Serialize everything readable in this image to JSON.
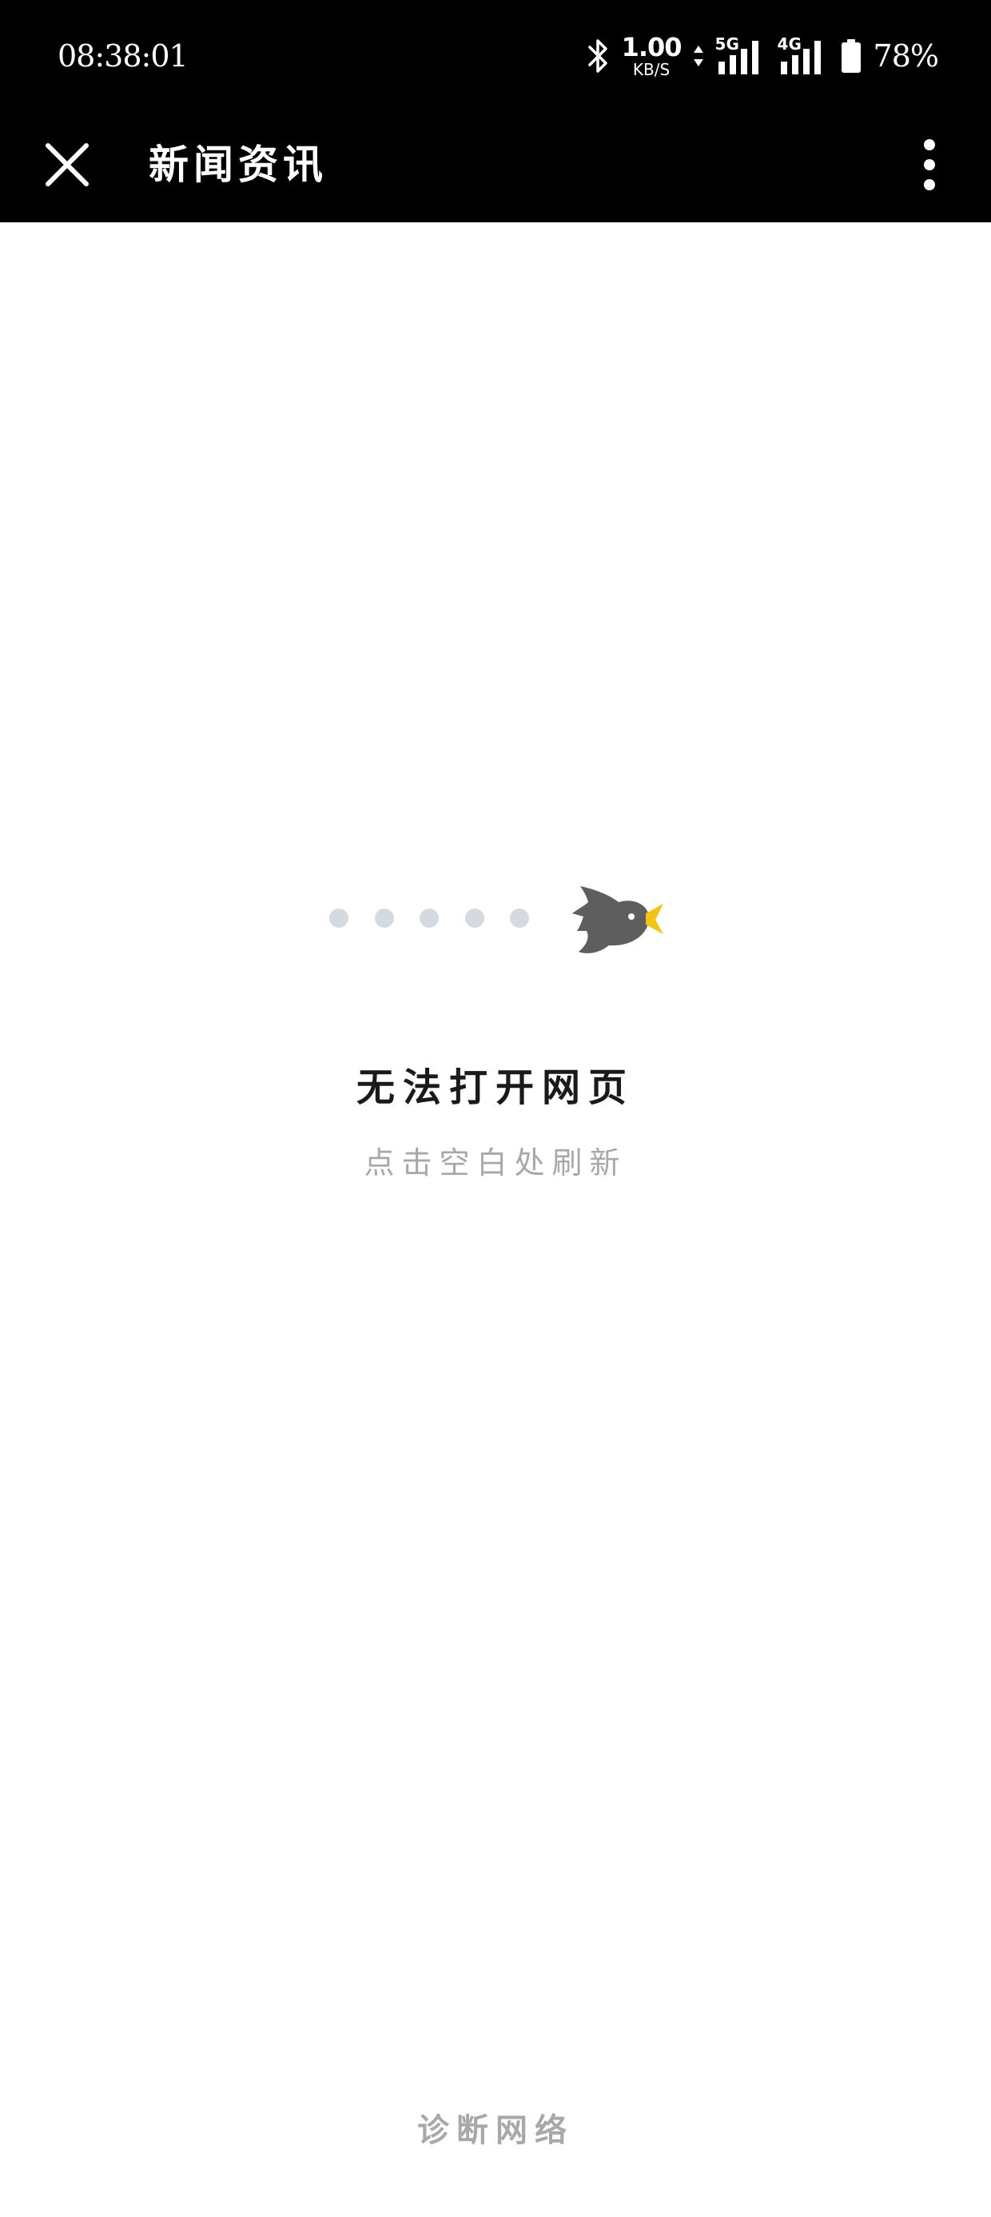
{
  "status_bar": {
    "time": "08:38:01",
    "net_speed_value": "1.00",
    "net_speed_unit": "KB/S",
    "signal1_label": "5G",
    "signal2_label": "4G",
    "battery": "78%",
    "icons": [
      "bluetooth-icon",
      "data-arrows-icon",
      "signal-5g-icon",
      "signal-4g-icon",
      "battery-icon"
    ]
  },
  "title_bar": {
    "title": "新闻资讯",
    "close_icon": "close-icon",
    "more_icon": "more-vertical-icon"
  },
  "error": {
    "illustration": "bird-icon",
    "dot_count": 5,
    "title": "无法打开网页",
    "subtitle": "点击空白处刷新"
  },
  "footer": {
    "diagnose_label": "诊断网络"
  },
  "colors": {
    "bar_background": "#000000",
    "dot": "#d5d9e0",
    "bird": "#5e5e5e",
    "bird_beak": "#f3c316",
    "muted_text": "#a8a8a8",
    "title_text": "#1a1a1a"
  }
}
